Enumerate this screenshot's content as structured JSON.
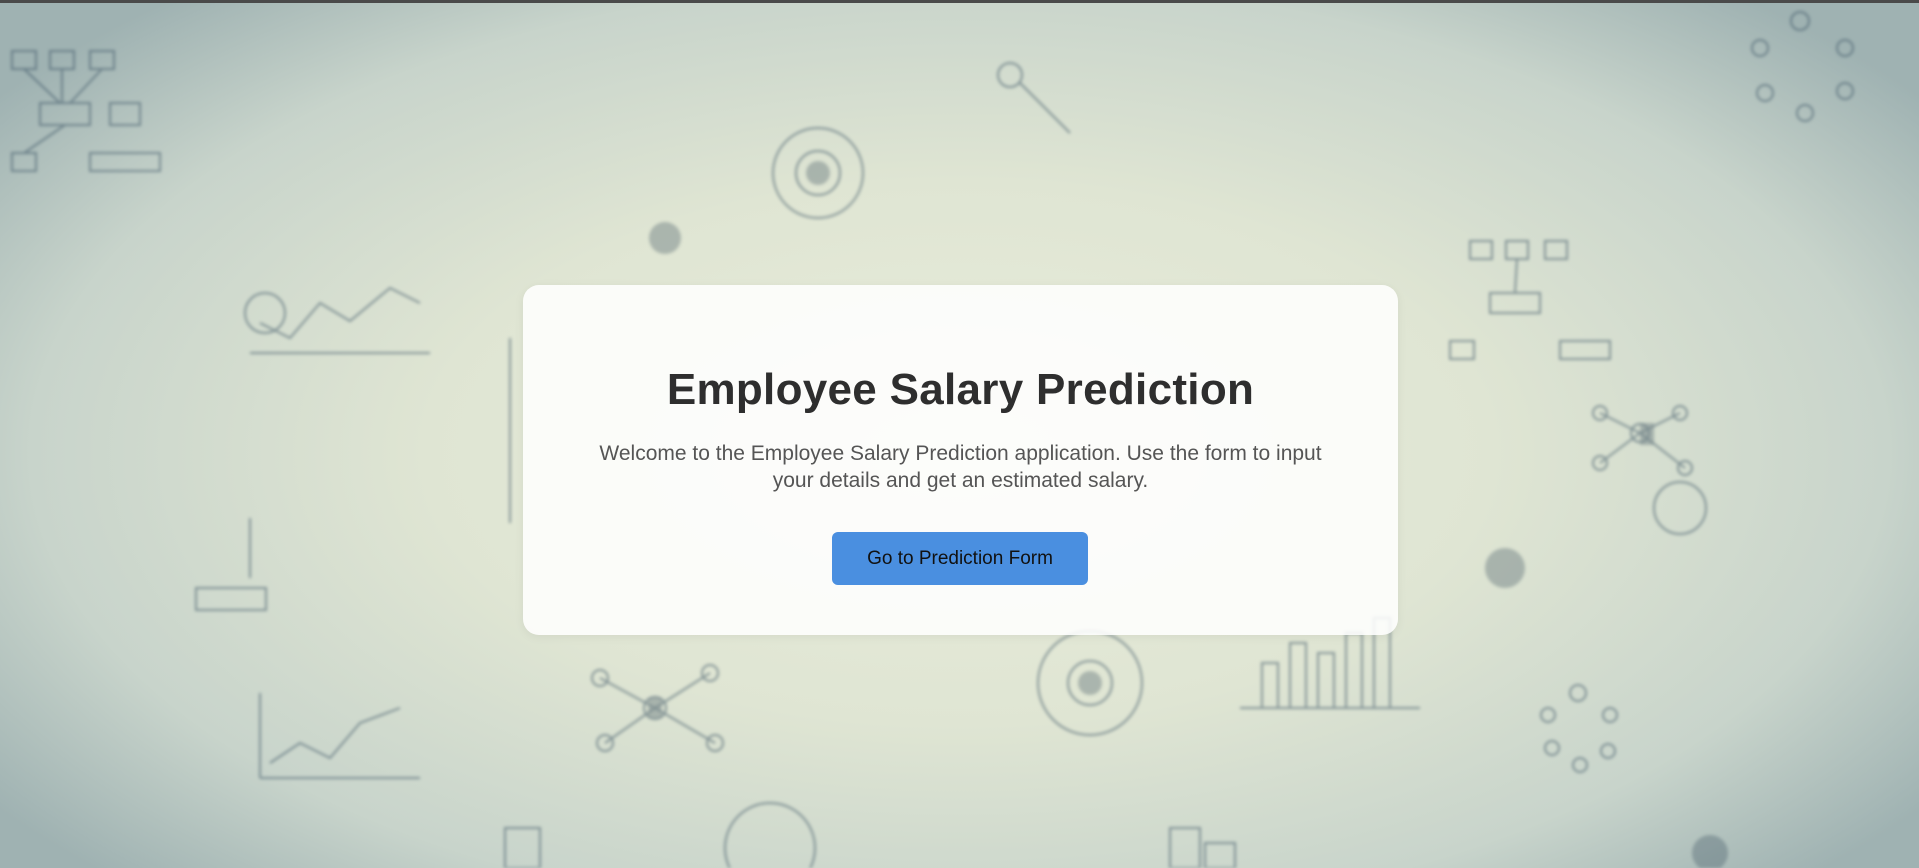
{
  "page": {
    "title": "Employee Salary Prediction",
    "description": "Welcome to the Employee Salary Prediction application. Use the form to input your details and get an estimated salary.",
    "cta_label": "Go to Prediction Form"
  },
  "colors": {
    "accent": "#4a8fe0",
    "title_text": "#2e2e2e",
    "body_text": "#555555",
    "card_bg": "#ffffff"
  },
  "background": {
    "theme": "blurred business analytics sketches"
  }
}
